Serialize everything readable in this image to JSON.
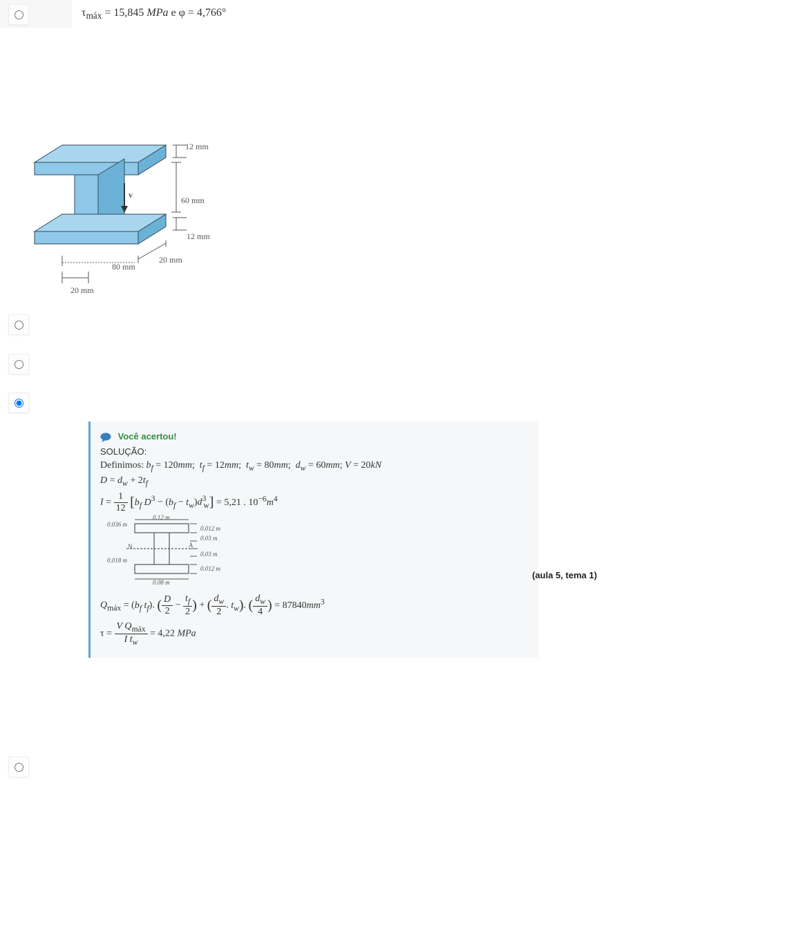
{
  "top_formula_html": "&tau;<sub>m&aacute;x</sub> = 15,845 <i>MPa</i> e &phi; = 4,766&deg;",
  "diagram": {
    "d_12mm_top": "12 mm",
    "d_60mm": "60 mm",
    "d_12mm_bot": "12 mm",
    "d_20mm_r": "20 mm",
    "d_80mm": "80 mm",
    "d_20mm_l": "20 mm",
    "d_v": "v"
  },
  "feedback": {
    "you_got_it": "Voc&ecirc; acertou!",
    "solution_label": "SOLU&Ccedil;&Atilde;O:",
    "line_def_html": "Definimos: <i>b<sub>f</sub></i> = 120<i>mm</i>; &nbsp;<i>t<sub>f</sub></i> = 12<i>mm</i>; &nbsp;<i>t<sub>w</sub></i> = 80<i>mm</i>; &nbsp;<i>d<sub>w</sub></i> = 60<i>mm</i>; <i>V</i> = 20<i>kN</i>",
    "line_D_html": "<i>D</i> = <i>d<sub>w</sub></i> + 2<i>t<sub>f</sub></i>",
    "line_I_result": "= 5,21 . 10<sup>&minus;6</sup><i>m</i><sup>4</sup>",
    "line_Q_result": "= 87840<i>mm</i><sup>3</sup>",
    "line_tau_result": "= 4,22 <i>MPa</i>",
    "mini": {
      "l1": "0.12 m",
      "l2": "0.012 m",
      "l3": "0.03 m",
      "l4": "0.03 m",
      "l5": "0.012 m",
      "l6": "0.08 m",
      "l7": "0.036 m",
      "l8": "0.018 m",
      "lA": "A",
      "lN": "N"
    }
  },
  "side_note": "(aula 5, tema 1)"
}
